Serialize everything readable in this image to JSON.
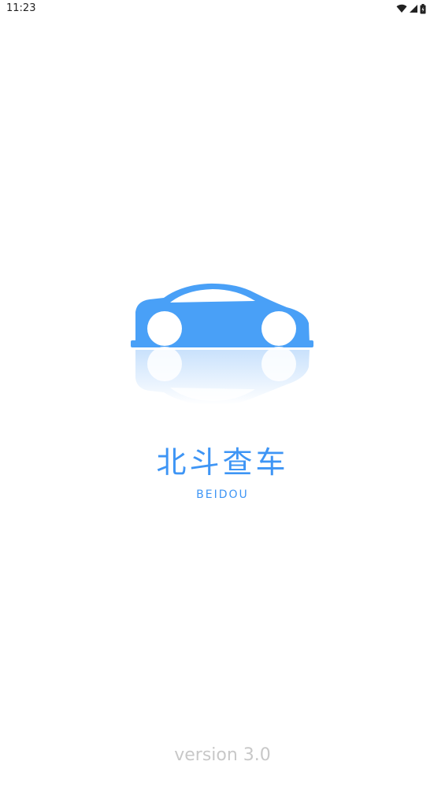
{
  "status_bar": {
    "time": "11:23",
    "icons": [
      "wifi-icon",
      "signal-icon",
      "battery-icon"
    ]
  },
  "splash": {
    "logo_icon": "car-icon",
    "app_name": "北斗查车",
    "app_subtitle": "BEIDOU",
    "version": "version 3.0"
  },
  "colors": {
    "accent": "#3e95f5",
    "version_text": "#c8c8c8",
    "background": "#ffffff"
  }
}
